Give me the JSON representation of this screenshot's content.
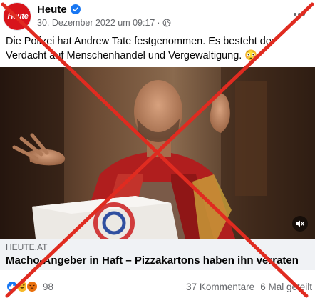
{
  "header": {
    "avatar_text": "Heute",
    "page_name": "Heute",
    "timestamp": "30. Dezember 2022 um 09:17",
    "dot": "·",
    "verified_icon": "verified-badge-icon",
    "privacy_icon": "globe-icon",
    "more_icon": "more-options-icon"
  },
  "post": {
    "caption": "Die Polizei hat Andrew Tate festgenommen. Es besteht der Verdacht auf Menschenhandel und Vergewaltigung. 😳"
  },
  "media": {
    "type": "video",
    "mute_icon": "speaker-muted-icon"
  },
  "link_preview": {
    "domain": "HEUTE.AT",
    "title": "Macho-Angeber in Haft – Pizzakartons haben ihn verraten"
  },
  "footer": {
    "reaction_icons": [
      "like-icon",
      "haha-icon",
      "angry-icon"
    ],
    "reaction_count": "98",
    "comments": "37 Kommentare",
    "shares": "6 Mal geteilt"
  },
  "overlay": {
    "cross_color": "#e02b20"
  },
  "colors": {
    "brand_red": "#d8141b",
    "facebook_blue": "#1877f2",
    "muted_text": "#65676b"
  }
}
